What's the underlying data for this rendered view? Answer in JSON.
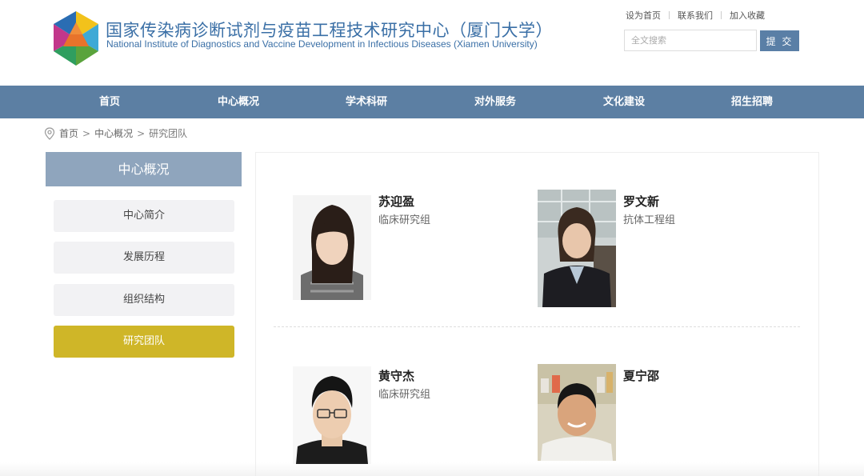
{
  "header": {
    "title": "国家传染病诊断试剂与疫苗工程技术研究中心（厦门大学）",
    "subtitle": "National Institute of Diagnostics and Vaccine Development in Infectious Diseases (Xiamen University)",
    "top_links": [
      "设为首页",
      "联系我们",
      "加入收藏"
    ],
    "search_placeholder": "全文搜索",
    "submit_label": "提 交"
  },
  "nav": [
    "首页",
    "中心概况",
    "学术科研",
    "对外服务",
    "文化建设",
    "招生招聘"
  ],
  "breadcrumb": [
    "首页",
    "中心概况",
    "研究团队"
  ],
  "sidebar": {
    "heading": "中心概况",
    "items": [
      {
        "label": "中心简介",
        "active": false
      },
      {
        "label": "发展历程",
        "active": false
      },
      {
        "label": "组织结构",
        "active": false
      },
      {
        "label": "研究团队",
        "active": true
      }
    ]
  },
  "team": [
    {
      "name": "苏迎盈",
      "group": "临床研究组"
    },
    {
      "name": "罗文新",
      "group": "抗体工程组"
    },
    {
      "name": "黄守杰",
      "group": "临床研究组"
    },
    {
      "name": "夏宁邵",
      "group": ""
    }
  ],
  "colors": {
    "brand_blue": "#3a6fa6",
    "nav_bg": "#5c7fa3",
    "sidebar_head": "#8fa5bd",
    "active_item": "#cfb628"
  }
}
